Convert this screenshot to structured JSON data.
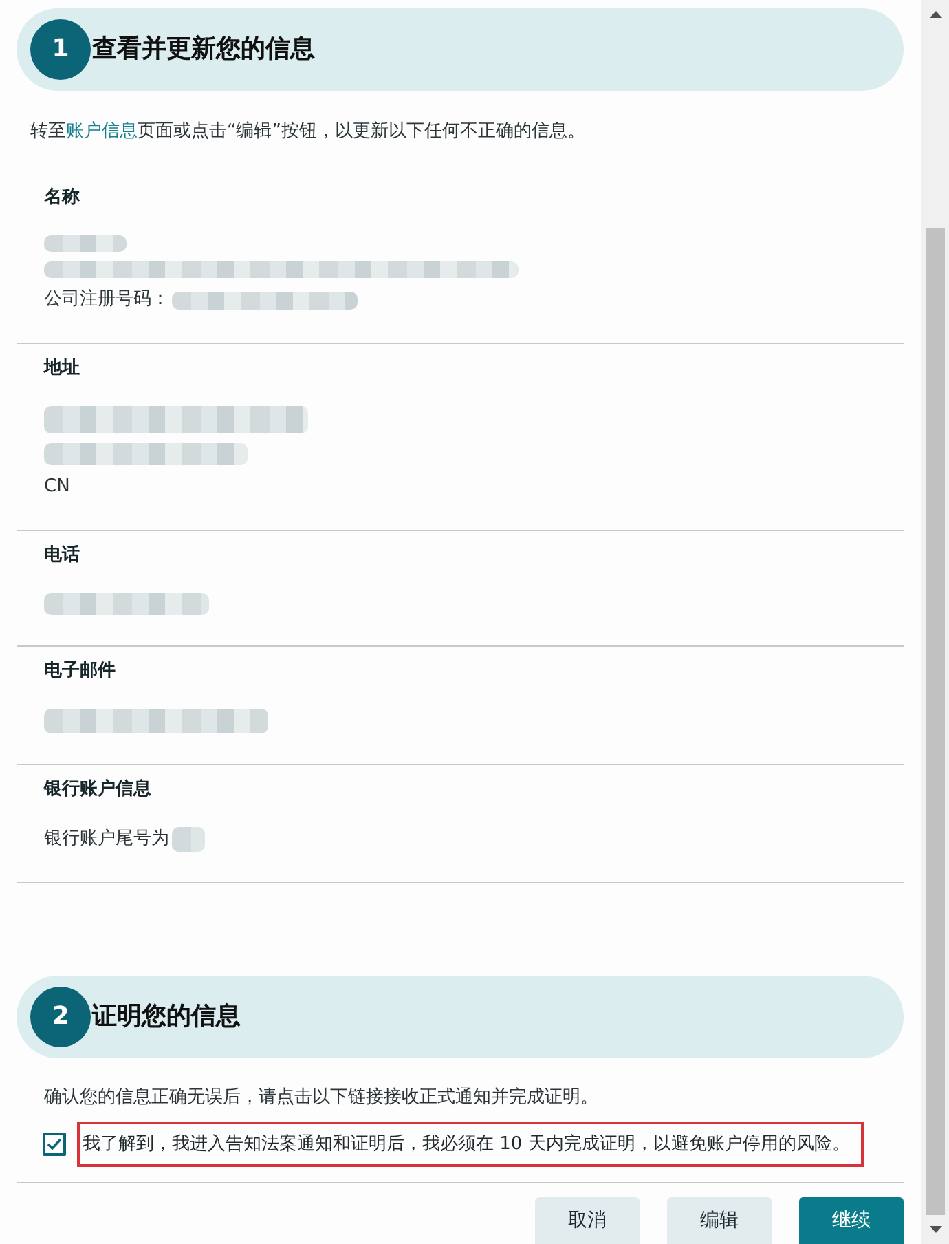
{
  "step_1": {
    "number": "1",
    "title": "查看并更新您的信息"
  },
  "intro": {
    "before": "转至",
    "link": "账户信息",
    "after": "页面或点击“编辑”按钮，以更新以下任何不正确的信息。"
  },
  "sections": [
    {
      "title": "名称",
      "lines": [
        {
          "kind": "redacted"
        },
        {
          "kind": "redacted"
        },
        {
          "kind": "text",
          "text": "公司注册号码：",
          "redacted_value": true
        }
      ]
    },
    {
      "title": "地址",
      "lines": [
        {
          "kind": "redacted"
        },
        {
          "kind": "redacted"
        },
        {
          "kind": "text",
          "text": "CN",
          "redacted_value": false
        }
      ]
    },
    {
      "title": "电话",
      "lines": [
        {
          "kind": "redacted"
        }
      ]
    },
    {
      "title": "电子邮件",
      "lines": [
        {
          "kind": "redacted"
        }
      ]
    },
    {
      "title": "银行账户信息",
      "lines": [
        {
          "kind": "text",
          "text": "银行账户尾号为",
          "redacted_value": true
        }
      ]
    }
  ],
  "step_2": {
    "number": "2",
    "title": "证明您的信息"
  },
  "confirm_text": "确认您的信息正确无误后，请点击以下链接接收正式通知并完成证明。",
  "acknowledgement": {
    "checked": true,
    "highlighted": true,
    "text": "我了解到，我进入告知法案通知和证明后，我必须在 10 天内完成证明，以避免账户停用的风险。"
  },
  "buttons": [
    {
      "label": "取消",
      "kind": "secondary"
    },
    {
      "label": "编辑",
      "kind": "secondary"
    },
    {
      "label": "继续",
      "kind": "primary"
    }
  ]
}
